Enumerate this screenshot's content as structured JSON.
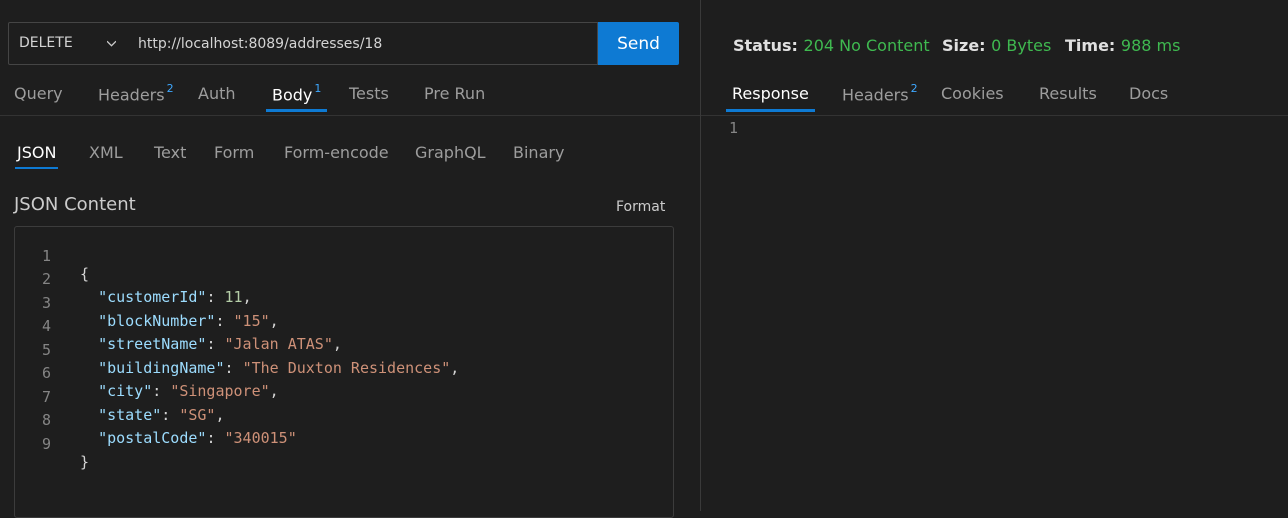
{
  "request": {
    "method": "DELETE",
    "url": "http://localhost:8089/addresses/18",
    "send_label": "Send"
  },
  "request_tabs": [
    {
      "label": "Query"
    },
    {
      "label": "Headers",
      "badge": "2"
    },
    {
      "label": "Auth"
    },
    {
      "label": "Body",
      "badge": "1",
      "active": true
    },
    {
      "label": "Tests"
    },
    {
      "label": "Pre Run"
    }
  ],
  "body_tabs": [
    {
      "label": "JSON",
      "active": true
    },
    {
      "label": "XML"
    },
    {
      "label": "Text"
    },
    {
      "label": "Form"
    },
    {
      "label": "Form-encode"
    },
    {
      "label": "GraphQL"
    },
    {
      "label": "Binary"
    }
  ],
  "body": {
    "section_title": "JSON Content",
    "format_label": "Format",
    "lines": [
      {
        "num": "1",
        "open": "{"
      },
      {
        "num": "2",
        "key": "\"customerId\"",
        "value": "11",
        "type": "number",
        "comma": true
      },
      {
        "num": "3",
        "key": "\"blockNumber\"",
        "value": "\"15\"",
        "type": "string",
        "comma": true
      },
      {
        "num": "4",
        "key": "\"streetName\"",
        "value": "\"Jalan ATAS\"",
        "type": "string",
        "comma": true
      },
      {
        "num": "5",
        "key": "\"buildingName\"",
        "value": "\"The Duxton Residences\"",
        "type": "string",
        "comma": true
      },
      {
        "num": "6",
        "key": "\"city\"",
        "value": "\"Singapore\"",
        "type": "string",
        "comma": true
      },
      {
        "num": "7",
        "key": "\"state\"",
        "value": "\"SG\"",
        "type": "string",
        "comma": true
      },
      {
        "num": "8",
        "key": "\"postalCode\"",
        "value": "\"340015\"",
        "type": "string",
        "comma": false
      },
      {
        "num": "9",
        "close": "}"
      }
    ]
  },
  "response": {
    "status_label": "Status:",
    "status_value": "204 No Content",
    "size_label": "Size:",
    "size_value": "0 Bytes",
    "time_label": "Time:",
    "time_value": "988 ms",
    "tabs": [
      {
        "label": "Response",
        "active": true
      },
      {
        "label": "Headers",
        "badge": "2"
      },
      {
        "label": "Cookies"
      },
      {
        "label": "Results"
      },
      {
        "label": "Docs"
      }
    ],
    "line_number": "1"
  },
  "colors": {
    "accent": "#0e7ad3",
    "status_ok": "#3fb950",
    "json_key": "#9cdcfe",
    "json_string": "#ce9178",
    "json_number": "#b5cea8"
  }
}
